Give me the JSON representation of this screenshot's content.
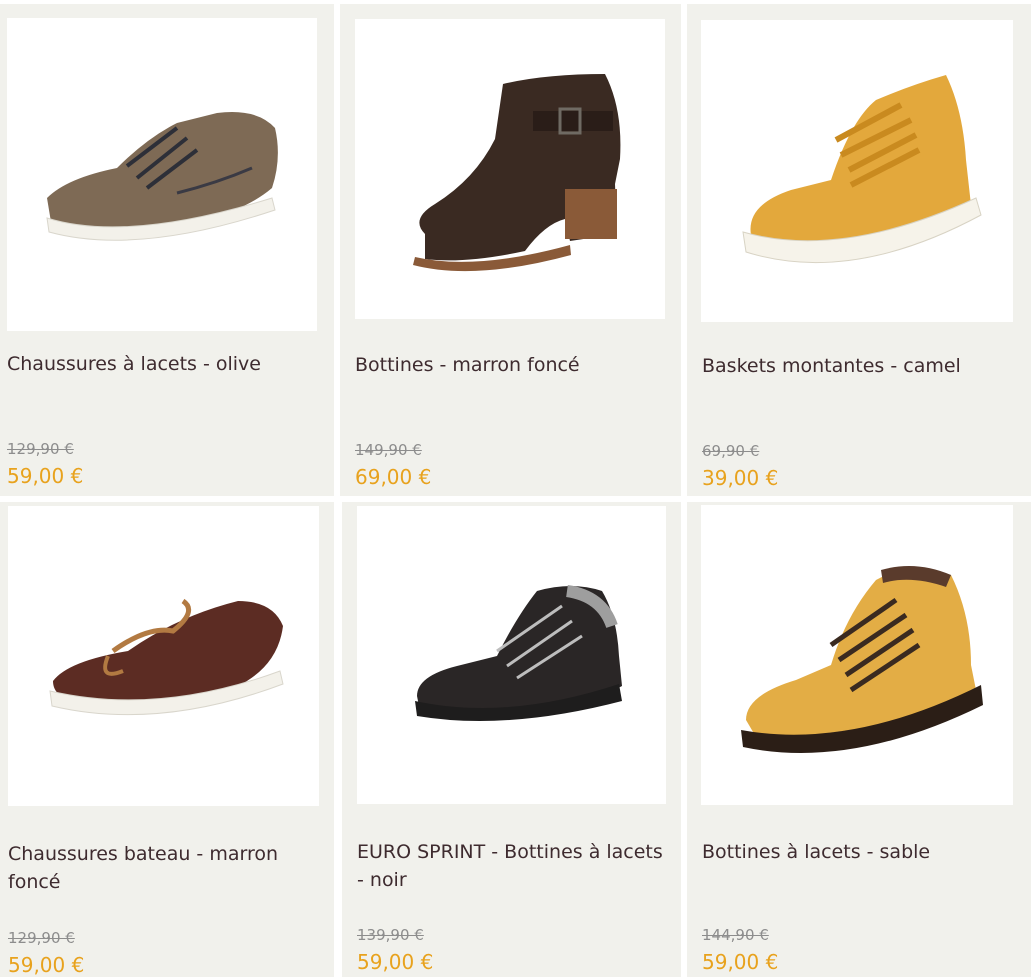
{
  "products": [
    {
      "name": "Chaussures à lacets - olive",
      "old_price": "129,90 €",
      "price": "59,00 €",
      "image_icon": "olive-chukka-shoe-icon",
      "colors": {
        "upper": "#7e6a55",
        "sole": "#f3f1ea"
      }
    },
    {
      "name": "Bottines - marron foncé",
      "old_price": "149,90 €",
      "price": "69,00 €",
      "image_icon": "dark-brown-ankle-boot-icon",
      "colors": {
        "upper": "#3a2a22",
        "sole": "#8a5a38"
      }
    },
    {
      "name": "Baskets montantes - camel",
      "old_price": "69,90 €",
      "price": "39,00 €",
      "image_icon": "camel-high-top-sneaker-icon",
      "colors": {
        "upper": "#e3a83c",
        "sole": "#f6f3ea"
      }
    },
    {
      "name": "Chaussures bateau - marron foncé",
      "old_price": "129,90 €",
      "price": "59,00 €",
      "image_icon": "brown-boat-shoe-icon",
      "colors": {
        "upper": "#5c2c23",
        "sole": "#f3f1ea"
      }
    },
    {
      "name": "EURO SPRINT - Bottines à lacets - noir",
      "old_price": "139,90 €",
      "price": "59,00 €",
      "image_icon": "black-hiking-boot-icon",
      "colors": {
        "upper": "#2a2626",
        "sole": "#1e1d1d"
      }
    },
    {
      "name": "Bottines à lacets - sable",
      "old_price": "144,90 €",
      "price": "59,00 €",
      "image_icon": "sand-lace-up-boot-icon",
      "colors": {
        "upper": "#e3ad45",
        "sole": "#2b1e16"
      }
    }
  ],
  "colors": {
    "card_bg": "#f1f1ec",
    "name_text": "#3e2b2f",
    "old_price_text": "#8d8d8d",
    "price_text": "#e8a21d"
  }
}
